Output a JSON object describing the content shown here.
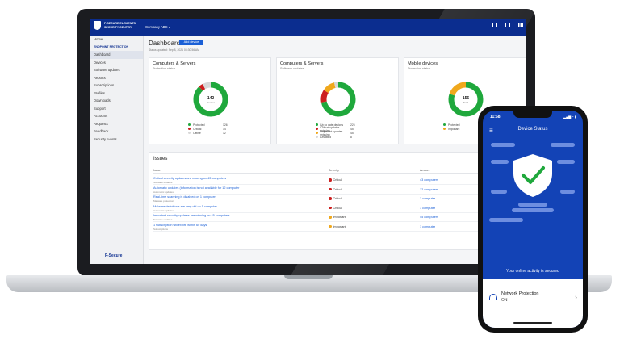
{
  "app": {
    "logo_text": "F-SECURE ELEMENTS\nSECURITY CENTER",
    "company": "Company ABC ▾",
    "brand_footer": "F-Secure"
  },
  "sidebar": {
    "items": [
      {
        "label": "Home",
        "type": "item"
      },
      {
        "label": "ENDPOINT PROTECTION",
        "type": "head"
      },
      {
        "label": "Dashboard",
        "type": "active"
      },
      {
        "label": "Devices",
        "type": "item"
      },
      {
        "label": "Software updates",
        "type": "item"
      },
      {
        "label": "Reports",
        "type": "item"
      },
      {
        "label": "Subscriptions",
        "type": "item"
      },
      {
        "label": "Profiles",
        "type": "item"
      },
      {
        "label": "Downloads",
        "type": "item"
      },
      {
        "label": "Support",
        "type": "item"
      },
      {
        "label": "Accounts",
        "type": "item"
      },
      {
        "label": "Requests",
        "type": "item"
      },
      {
        "label": "Feedback",
        "type": "item"
      },
      {
        "label": "Security events",
        "type": "item"
      }
    ]
  },
  "dashboard": {
    "title": "Dashboard",
    "add_button": "Add device",
    "status_updated": "Status updated: Sep 8, 2021 08:30:56 AM",
    "cards": [
      {
        "title": "Computers & Servers",
        "subtitle": "Protection status",
        "center_value": "142",
        "center_label": "devices",
        "segments": [
          {
            "label": "Protected",
            "value": "126",
            "frac": 0.88,
            "color": "#1fa83c"
          },
          {
            "label": "Critical",
            "value": "14",
            "frac": 0.04,
            "color": "#cc1f1f"
          },
          {
            "label": "Offline",
            "value": "12",
            "frac": 0.08,
            "color": "#d8d8d8"
          }
        ]
      },
      {
        "title": "Computers & Servers",
        "subtitle": "Software updates",
        "center_value": "",
        "center_label": "",
        "segments": [
          {
            "label": "Up to date devices",
            "value": "226",
            "frac": 0.72,
            "color": "#1fa83c"
          },
          {
            "label": "Critical updates missing",
            "value": "45",
            "frac": 0.12,
            "color": "#cc1f1f"
          },
          {
            "label": "Important updates missing",
            "value": "45",
            "frac": 0.12,
            "color": "#f0a81c"
          },
          {
            "label": "Disabled",
            "value": "8",
            "frac": 0.04,
            "color": "#d8d8d8"
          }
        ]
      },
      {
        "title": "Mobile devices",
        "subtitle": "Protection status",
        "center_value": "156",
        "center_label": "Total",
        "segments": [
          {
            "label": "Protected",
            "value": "95",
            "frac": 0.8,
            "color": "#1fa83c"
          },
          {
            "label": "Important",
            "value": "15",
            "frac": 0.2,
            "color": "#f0a81c"
          }
        ]
      }
    ]
  },
  "issues": {
    "title": "Issues",
    "headers": {
      "issue": "Issue",
      "severity": "Severity",
      "amount": "Amount"
    },
    "rows": [
      {
        "name": "Critical security updates are missing on 43 computers",
        "category": "Software updates",
        "severity": "Critical",
        "sev_color": "#cc1f1f",
        "amount": "43 computers"
      },
      {
        "name": "Automatic updates (information is not available for 12 computer",
        "category": "Automatic updates",
        "severity": "Critical",
        "sev_color": "#cc1f1f",
        "amount": "12 computers"
      },
      {
        "name": "Real-time scanning is disabled on 1 computer",
        "category": "Malware protection",
        "severity": "Critical",
        "sev_color": "#cc1f1f",
        "amount": "1 computer"
      },
      {
        "name": "Malware definitions are very old on 1 computer",
        "category": "Automatic updates",
        "severity": "Critical",
        "sev_color": "#cc1f1f",
        "amount": "1 computer"
      },
      {
        "name": "Important security updates are missing on 45 computers",
        "category": "Software updates",
        "severity": "Important",
        "sev_color": "#f0a81c",
        "amount": "45 computers"
      },
      {
        "name": "1 subscription will expire within 60 days",
        "category": "Subscriptions",
        "severity": "Important",
        "sev_color": "#f0a81c",
        "amount": "1 computer"
      }
    ]
  },
  "phone": {
    "time": "11:58",
    "status_icons": "▂▄▆ ◔ ▮",
    "title": "Device Status",
    "secured_text": "Your online activity is secured",
    "network_title": "Network Protection",
    "network_status": "ON",
    "accent": "#1343b6"
  }
}
